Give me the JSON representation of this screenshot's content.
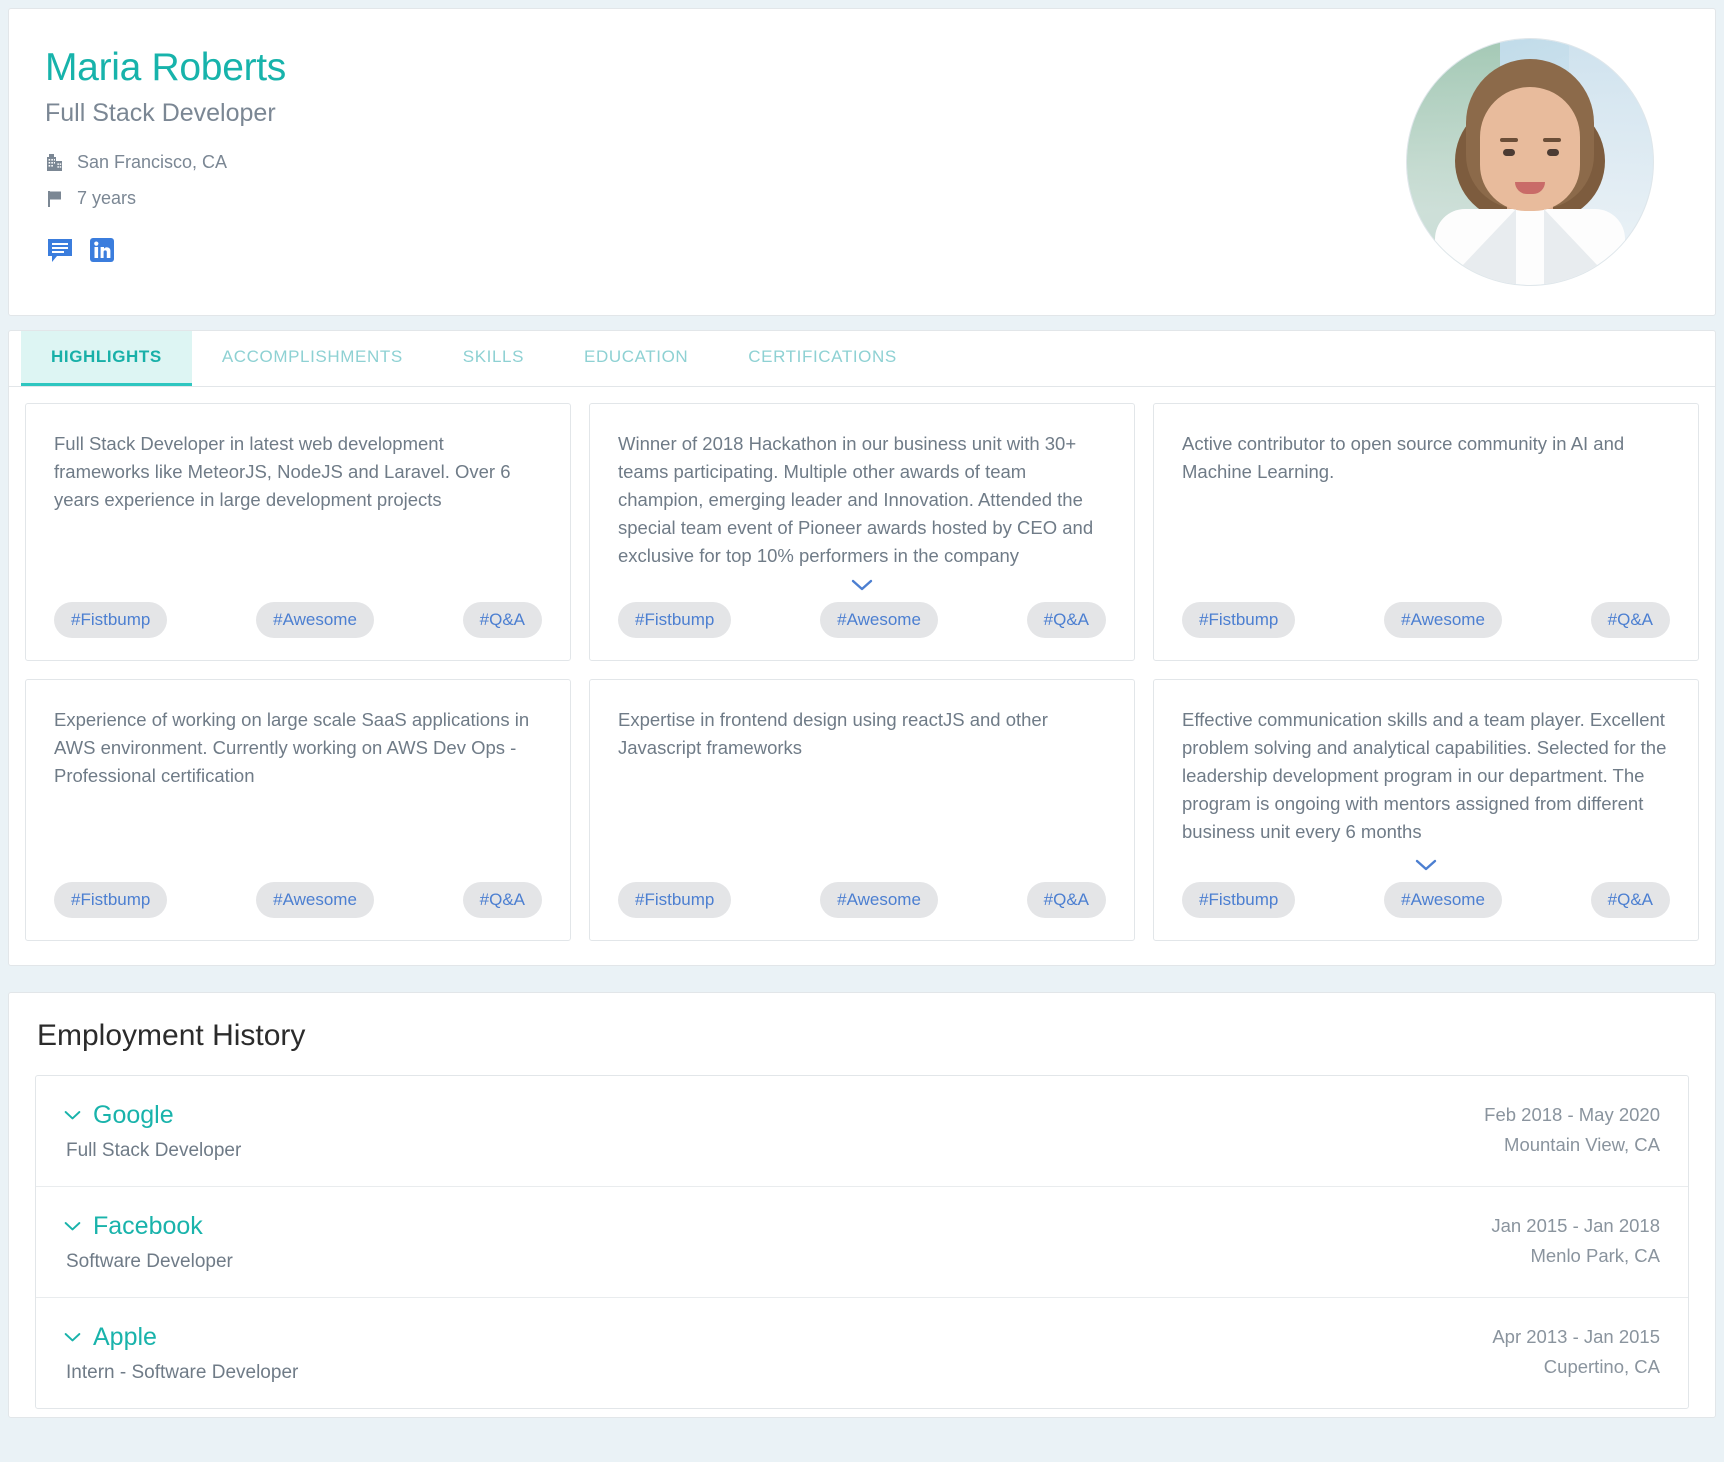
{
  "profile": {
    "name": "Maria Roberts",
    "title": "Full Stack Developer",
    "location": "San Francisco, CA",
    "location_icon": "building-icon",
    "experience": "7 years",
    "experience_icon": "flag-icon",
    "social": [
      {
        "name": "message-icon",
        "label": "Message",
        "color": "#3b7ddd"
      },
      {
        "name": "linkedin-icon",
        "label": "LinkedIn",
        "color": "#3b7ddd"
      }
    ],
    "avatar_alt": "Profile photo of Maria Roberts",
    "accent_color": "#17b3ab",
    "muted_color": "#7b8794"
  },
  "tabs": [
    {
      "label": "HIGHLIGHTS",
      "active": true
    },
    {
      "label": "ACCOMPLISHMENTS",
      "active": false
    },
    {
      "label": "SKILLS",
      "active": false
    },
    {
      "label": "EDUCATION",
      "active": false
    },
    {
      "label": "CERTIFICATIONS",
      "active": false
    }
  ],
  "chips": {
    "fistbump": "#Fistbump",
    "awesome": "#Awesome",
    "qa": "#Q&A",
    "background_color": "#e4e5e7",
    "text_color": "#4c7fd1"
  },
  "highlights": [
    {
      "text": "Full Stack Developer in latest web development frameworks like MeteorJS, NodeJS and Laravel. Over 6 years experience in large development projects",
      "expandable": false
    },
    {
      "text": "Winner of 2018 Hackathon in our business unit with 30+ teams participating. Multiple other awards of team champion, emerging leader and Innovation. Attended the special team event of Pioneer awards hosted by CEO and exclusive for top 10% performers in the company",
      "expandable": true
    },
    {
      "text": "Active contributor to open source community in AI and Machine Learning.",
      "expandable": false
    },
    {
      "text": "Experience of working on large scale SaaS applications in AWS environment. Currently working on AWS Dev Ops - Professional certification",
      "expandable": false
    },
    {
      "text": "Expertise in frontend design using reactJS and other Javascript frameworks",
      "expandable": false
    },
    {
      "text": "Effective communication skills and a team player. Excellent problem solving and analytical capabilities. Selected for the leadership development program in our department. The program is ongoing with mentors assigned from different business unit every 6 months",
      "expandable": true
    }
  ],
  "employment": {
    "heading": "Employment History",
    "entries": [
      {
        "company": "Google",
        "role": "Full Stack Developer",
        "dates": "Feb 2018 - May 2020",
        "location": "Mountain View, CA"
      },
      {
        "company": "Facebook",
        "role": "Software Developer",
        "dates": "Jan 2015 - Jan 2018",
        "location": "Menlo Park, CA"
      },
      {
        "company": "Apple",
        "role": "Intern - Software Developer",
        "dates": "Apr 2013 - Jan 2015",
        "location": "Cupertino, CA"
      }
    ]
  }
}
